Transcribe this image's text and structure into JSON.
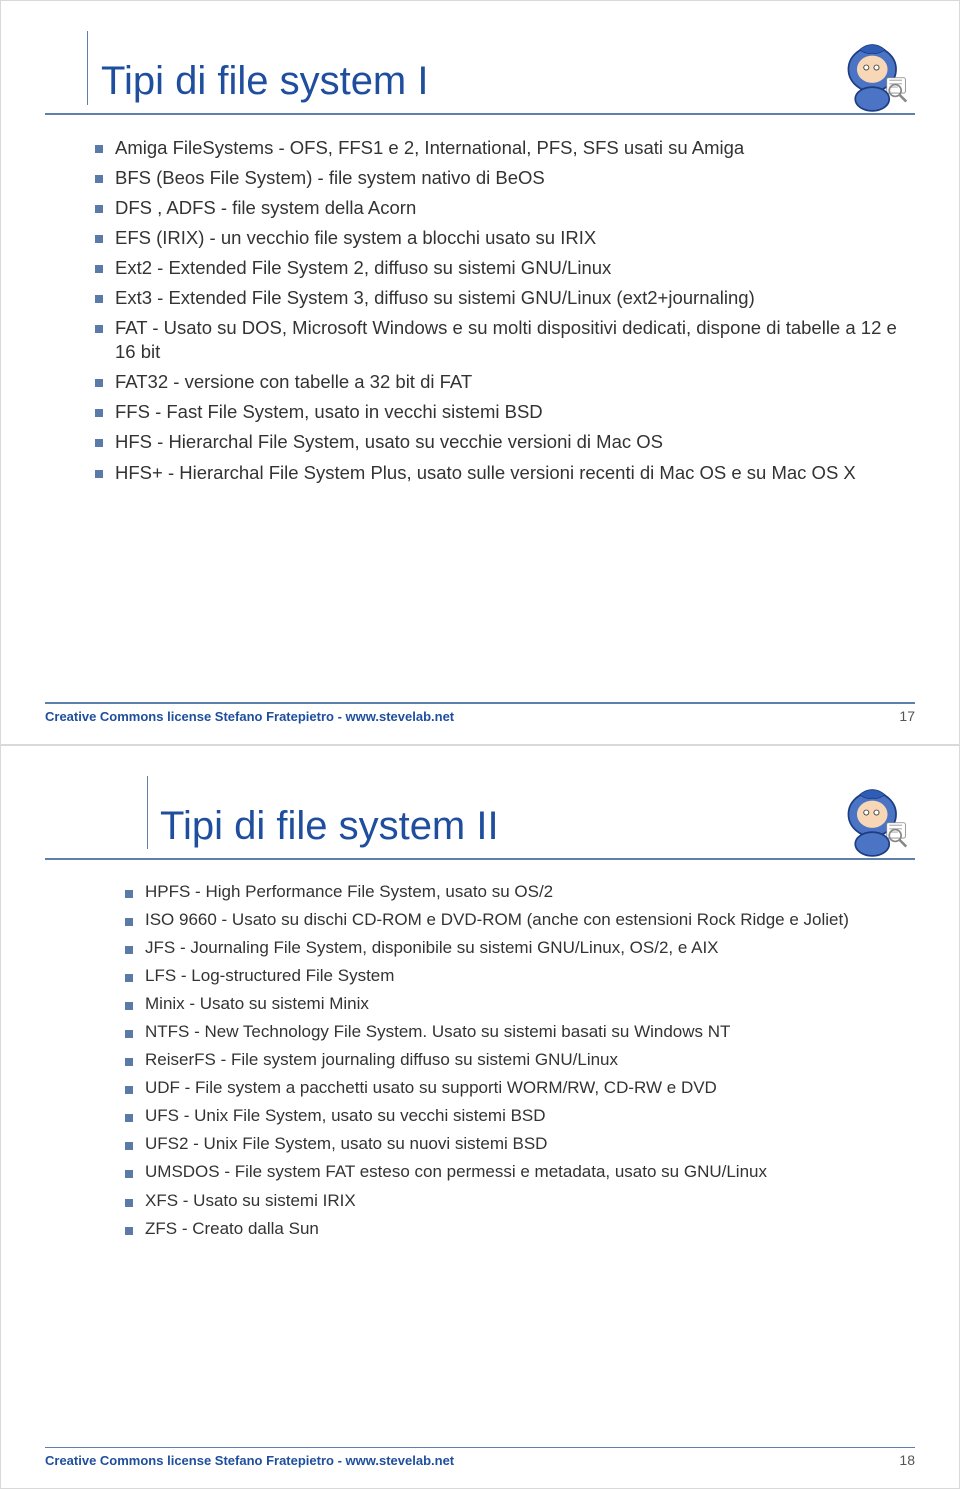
{
  "slides": [
    {
      "title": "Tipi di file system I",
      "items": [
        "Amiga FileSystems - OFS, FFS1 e 2, International, PFS, SFS usati su Amiga",
        "BFS (Beos File System) - file system nativo di BeOS",
        "DFS , ADFS - file system della Acorn",
        "EFS (IRIX) - un vecchio file system a blocchi usato su IRIX",
        "Ext2 - Extended File System 2, diffuso su sistemi GNU/Linux",
        "Ext3 - Extended File System 3, diffuso su sistemi GNU/Linux (ext2+journaling)",
        "FAT - Usato su DOS, Microsoft Windows e su molti dispositivi dedicati, dispone di tabelle a 12 e 16 bit",
        "FAT32 - versione con tabelle a 32 bit di FAT",
        "FFS - Fast File System, usato in vecchi sistemi BSD",
        "HFS - Hierarchal File System, usato su vecchie versioni di Mac OS",
        "HFS+ - Hierarchal File System Plus, usato sulle versioni recenti di Mac OS e su Mac OS X"
      ],
      "footer": "Creative Commons license  Stefano Fratepietro - www.stevelab.net",
      "page": "17"
    },
    {
      "title": "Tipi di file system II",
      "items": [
        "HPFS - High Performance File System, usato su OS/2",
        "ISO 9660 - Usato su dischi CD-ROM e DVD-ROM (anche con estensioni Rock Ridge e Joliet)",
        "JFS - Journaling File System, disponibile su sistemi GNU/Linux, OS/2, e AIX",
        "LFS - Log-structured File System",
        "Minix - Usato su sistemi Minix",
        "NTFS - New Technology File System. Usato su sistemi basati su Windows NT",
        "ReiserFS - File system journaling diffuso su sistemi GNU/Linux",
        "UDF - File system a pacchetti usato su supporti WORM/RW, CD-RW e DVD",
        "UFS - Unix File System, usato su vecchi sistemi BSD",
        "UFS2 - Unix File System, usato su nuovi sistemi BSD",
        "UMSDOS - File system FAT esteso con permessi e metadata, usato su GNU/Linux",
        "XFS - Usato su sistemi IRIX",
        "ZFS - Creato dalla Sun"
      ],
      "footer": "Creative Commons license  Stefano Fratepietro - www.stevelab.net",
      "page": "18"
    }
  ]
}
